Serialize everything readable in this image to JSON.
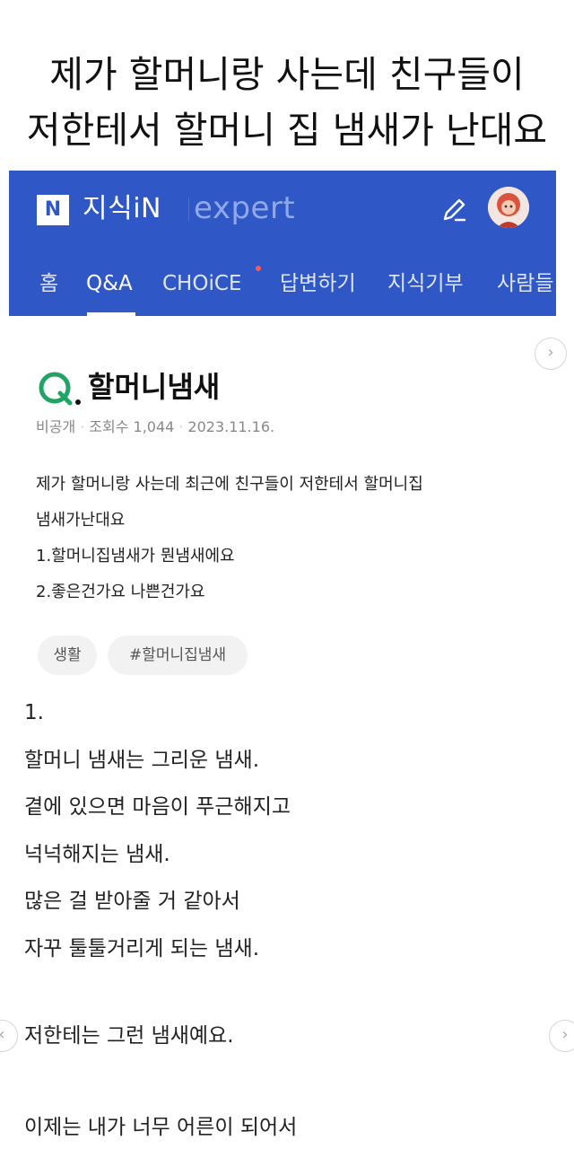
{
  "headline": {
    "line1": "제가 할머니랑 사는데 친구들이",
    "line2": "저한테서 할머니 집 냄새가 난대요"
  },
  "header": {
    "logo_mark": "N",
    "logo_text": "지식iN",
    "logo_expert": "expert",
    "tabs": [
      "홈",
      "Q&A",
      "CHOiCE",
      "답변하기",
      "지식기부",
      "사람들"
    ],
    "active_tab": "Q&A",
    "brand_color": "#2f57c6"
  },
  "question": {
    "title": "할머니냄새",
    "meta": {
      "author": "비공개",
      "views": "조회수 1,044",
      "date": "2023.11.16."
    },
    "body": [
      "제가 할머니랑 사는데 최근에 친구들이 저한테서 할머니집",
      "냄새가난대요",
      "1.할머니집냄새가 뭔냄새에요",
      "2.좋은건가요 나쁜건가요"
    ],
    "tags": [
      "생활",
      "#할머니집냄새"
    ]
  },
  "answer": {
    "lines": [
      "1.",
      "할머니 냄새는 그리운 냄새.",
      "곁에 있으면 마음이 푸근해지고",
      "넉넉해지는 냄새.",
      "많은 걸 받아줄 거 같아서",
      "자꾸 툴툴거리게 되는 냄새."
    ],
    "line_after": "저한테는 그런 냄새예요.",
    "line_last": "이제는 내가 너무 어른이 되어서"
  },
  "icons": {
    "pen": "pen-icon",
    "avatar": "avatar-icon",
    "arrow": "chevron-right-icon",
    "q_mark": "q-mark-icon"
  }
}
